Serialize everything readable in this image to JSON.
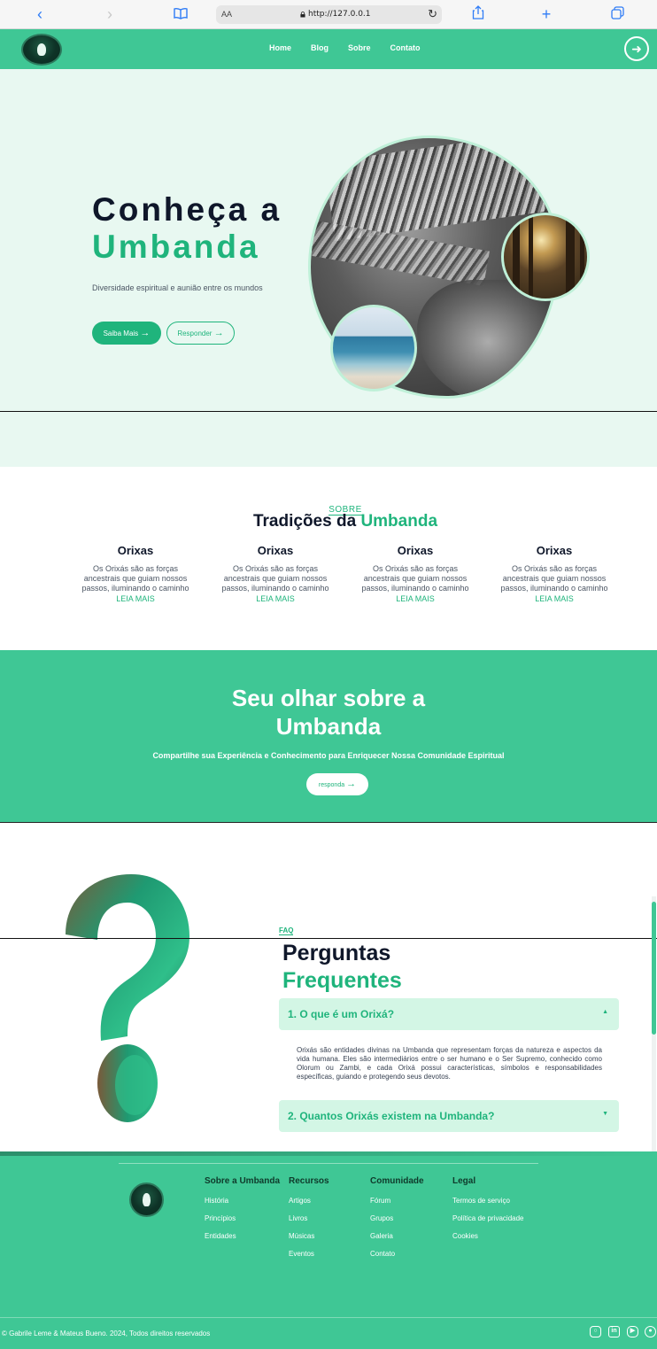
{
  "browser": {
    "url": "http://127.0.0.1",
    "text_size_label": "AA"
  },
  "nav": {
    "links": [
      "Home",
      "Blog",
      "Sobre",
      "Contato"
    ]
  },
  "hero": {
    "title_line1": "Conheça a",
    "title_line2": "Umbanda",
    "subtitle": "Diversidade espiritual e aunião entre os mundos",
    "primary_button": "Saiba Mais",
    "secondary_button": "Responder"
  },
  "about": {
    "kicker": "SOBRE",
    "title_prefix": "Tradições da ",
    "title_highlight": "Umbanda",
    "cards": [
      {
        "title": "Orixas",
        "text": "Os Orixás são as forças ancestrais que guiam nossos passos, iluminando o caminho",
        "link": "LEIA MAIS"
      },
      {
        "title": "Orixas",
        "text": "Os Orixás são as forças ancestrais que guiam nossos passos, iluminando o caminho",
        "link": "LEIA MAIS"
      },
      {
        "title": "Orixas",
        "text": "Os Orixás são as forças ancestrais que guiam nossos passos, iluminando o caminho",
        "link": "LEIA MAIS"
      },
      {
        "title": "Orixas",
        "text": "Os Orixás são as forças ancestrais que guiam nossos passos, iluminando o caminho",
        "link": "LEIA MAIS"
      }
    ]
  },
  "cta": {
    "title_line1": "Seu olhar sobre a",
    "title_line2": "Umbanda",
    "subtitle": "Compartilhe sua Experiência e Conhecimento para Enriquecer Nossa Comunidade Espiritual",
    "button": "responda"
  },
  "faq": {
    "kicker": "FAQ",
    "title_line1": "Perguntas",
    "title_line2": "Frequentes",
    "items": [
      {
        "question": "1. O que é um Orixá?",
        "expanded": true,
        "answer": "Orixás são entidades divinas na Umbanda que representam forças da natureza e aspectos da vida humana. Eles são intermediários entre o ser humano e o Ser Supremo, conhecido como Olorum ou Zambi, e cada Orixá possui características, símbolos e responsabilidades específicas, guiando e protegendo seus devotos."
      },
      {
        "question": "2. Quantos Orixás existem na Umbanda?",
        "expanded": false
      }
    ]
  },
  "footer": {
    "columns": [
      {
        "title": "Sobre a Umbanda",
        "links": [
          "História",
          "Princípios",
          "Entidades"
        ]
      },
      {
        "title": "Recursos",
        "links": [
          "Artigos",
          "Livros",
          "Músicas",
          "Eventos"
        ]
      },
      {
        "title": "Comunidade",
        "links": [
          "Fórum",
          "Grupos",
          "Galeria",
          "Contato"
        ]
      },
      {
        "title": "Legal",
        "links": [
          "Termos de serviço",
          "Política de privacidade",
          "Cookies"
        ]
      }
    ],
    "copyright": "© Gabrile Leme & Mateus Bueno. 2024, Todos direitos reservados",
    "social_icons": [
      "instagram-icon",
      "linkedin-icon",
      "youtube-icon",
      "github-icon"
    ]
  },
  "colors": {
    "brand": "#3fc795",
    "accent": "#1fb47c",
    "hero_bg": "#e8f8f1",
    "faq_item_bg": "#d3f6e5",
    "dark_text": "#0f172a"
  }
}
